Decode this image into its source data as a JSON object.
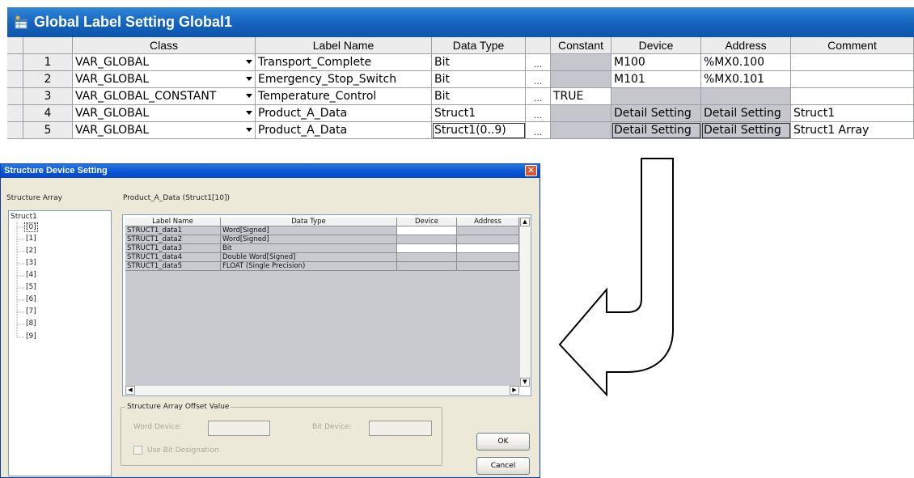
{
  "global_label_window": {
    "title": "Global Label Setting Global1",
    "columns": [
      "Class",
      "Label Name",
      "Data Type",
      "Constant",
      "Device",
      "Address",
      "Comment"
    ],
    "rows": [
      {
        "no": "1",
        "class": "VAR_GLOBAL",
        "label": "Transport_Complete",
        "type": "Bit",
        "constant": "",
        "device": "M100",
        "address": "%MX0.100",
        "comment": ""
      },
      {
        "no": "2",
        "class": "VAR_GLOBAL",
        "label": "Emergency_Stop_Switch",
        "type": "Bit",
        "constant": "",
        "device": "M101",
        "address": "%MX0.101",
        "comment": ""
      },
      {
        "no": "3",
        "class": "VAR_GLOBAL_CONSTANT",
        "label": "Temperature_Control",
        "type": "Bit",
        "constant": "TRUE",
        "device": "",
        "address": "",
        "comment": ""
      },
      {
        "no": "4",
        "class": "VAR_GLOBAL",
        "label": "Product_A_Data",
        "type": "Struct1",
        "constant": "",
        "device": "Detail Setting",
        "address": "Detail Setting",
        "comment": "Struct1"
      },
      {
        "no": "5",
        "class": "VAR_GLOBAL",
        "label": "Product_A_Data",
        "type": "Struct1(0..9)",
        "constant": "",
        "device": "Detail Setting",
        "address": "Detail Setting",
        "comment": "Struct1 Array"
      }
    ],
    "ellipsis": "..."
  },
  "dialog": {
    "title": "Structure Device Setting",
    "close": "✕",
    "structure_array_label": "Structure Array",
    "label_ref": "Product_A_Data (Struct1[10])",
    "tree_root": "Struct1",
    "tree_items": [
      "[0]",
      "[1]",
      "[2]",
      "[3]",
      "[4]",
      "[5]",
      "[6]",
      "[7]",
      "[8]",
      "[9]"
    ],
    "grid_columns": [
      "Label Name",
      "Data Type",
      "Device",
      "Address"
    ],
    "grid_rows": [
      {
        "label": "STRUCT1_data1",
        "type": "Word[Signed]"
      },
      {
        "label": "STRUCT1_data2",
        "type": "Word[Signed]"
      },
      {
        "label": "STRUCT1_data3",
        "type": "Bit"
      },
      {
        "label": "STRUCT1_data4",
        "type": "Double Word[Signed]"
      },
      {
        "label": "STRUCT1_data5",
        "type": "FLOAT (Single Precision)"
      }
    ],
    "offset_group": "Structure Array Offset Value",
    "word_device_label": "Word Device:",
    "bit_device_label": "Bit Device:",
    "use_bit_label": "Use Bit Designation",
    "ok": "OK",
    "cancel": "Cancel"
  },
  "colors": {
    "title_blue": "#1563bd",
    "dialog_face": "#ece9d8",
    "grid_gray": "#c5c7cc"
  }
}
